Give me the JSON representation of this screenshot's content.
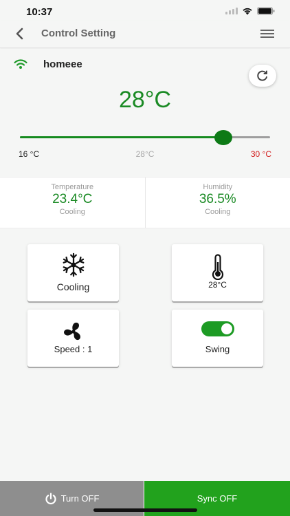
{
  "status_bar": {
    "time": "10:37"
  },
  "nav": {
    "title": "Control Setting"
  },
  "device": {
    "name": "homeee"
  },
  "set_temperature": "28°C",
  "slider": {
    "min_label": "16 °C",
    "current_label": "28°C",
    "max_label": "30 °C",
    "min": 16,
    "max": 30,
    "value": 27.4
  },
  "readings": [
    {
      "label": "Temperature",
      "value": "23.4°C",
      "sub": "Cooling"
    },
    {
      "label": "Humidity",
      "value": "36.5%",
      "sub": "Cooling"
    }
  ],
  "controls": {
    "mode": {
      "label": "Cooling",
      "icon": "snowflake-icon"
    },
    "temp": {
      "label": "28°C",
      "icon": "thermometer-icon"
    },
    "fan": {
      "label": "Speed : 1",
      "icon": "fan-icon"
    },
    "swing": {
      "label": "Swing",
      "on": true
    }
  },
  "bottom": {
    "off_label": "Turn OFF",
    "sync_label": "Sync OFF"
  },
  "colors": {
    "accent": "#1a8a24",
    "sync": "#22a21d",
    "off": "#8e8e8e",
    "max_temp": "#d21c1c"
  }
}
